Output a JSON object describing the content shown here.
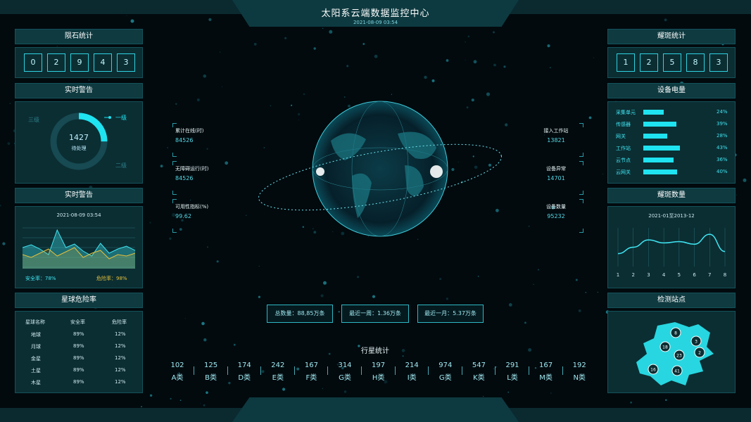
{
  "header": {
    "title": "太阳系云端数据监控中心",
    "datetime": "2021-08-09  03:54"
  },
  "meteor": {
    "title": "陨石统计",
    "digits": [
      "0",
      "2",
      "9",
      "4",
      "3"
    ]
  },
  "alert1": {
    "title": "实时警告",
    "center_value": "1427",
    "center_label": "待处理",
    "level1": "一级",
    "level2": "二级",
    "level3": "三级",
    "progress": 0.25
  },
  "alert2": {
    "title": "实时警告",
    "datetime": "2021-08-09  03:54",
    "safe_label": "安全率：78%",
    "danger_label": "危险率：98%",
    "chart_data": {
      "type": "area",
      "series": [
        {
          "name": "安全率",
          "values": [
            30,
            34,
            28,
            20,
            55,
            30,
            35,
            25,
            18,
            36,
            22,
            28,
            32,
            26
          ]
        },
        {
          "name": "危险率",
          "values": [
            20,
            16,
            22,
            28,
            18,
            24,
            30,
            16,
            22,
            26,
            14,
            20,
            18,
            22
          ]
        }
      ]
    }
  },
  "danger": {
    "title": "星球危险率",
    "headers": [
      "星球名称",
      "安全率",
      "危险率"
    ],
    "rows": [
      [
        "地球",
        "89%",
        "12%"
      ],
      [
        "月球",
        "89%",
        "12%"
      ],
      [
        "金星",
        "89%",
        "12%"
      ],
      [
        "土星",
        "89%",
        "12%"
      ],
      [
        "木星",
        "89%",
        "12%"
      ]
    ]
  },
  "left_stats": [
    {
      "label": "累计在线(时)",
      "value": "84526"
    },
    {
      "label": "无障碍运行(时)",
      "value": "84526"
    },
    {
      "label": "可用性指标(%)",
      "value": "99.62"
    }
  ],
  "right_stats": [
    {
      "label": "接入工作站",
      "value": "13821"
    },
    {
      "label": "设备异常",
      "value": "14701"
    },
    {
      "label": "设备数量",
      "value": "95232"
    }
  ],
  "info": {
    "total": "总数量：88,85万条",
    "week": "最近一周：1.36万条",
    "month": "最近一月：5.37万条"
  },
  "planets": {
    "title": "行星统计",
    "items": [
      {
        "num": "102",
        "label": "A类"
      },
      {
        "num": "125",
        "label": "B类"
      },
      {
        "num": "174",
        "label": "D类"
      },
      {
        "num": "242",
        "label": "E类"
      },
      {
        "num": "167",
        "label": "F类"
      },
      {
        "num": "314",
        "label": "G类"
      },
      {
        "num": "197",
        "label": "H类"
      },
      {
        "num": "214",
        "label": "I类"
      },
      {
        "num": "974",
        "label": "G类"
      },
      {
        "num": "547",
        "label": "K类"
      },
      {
        "num": "291",
        "label": "L类"
      },
      {
        "num": "167",
        "label": "M类"
      },
      {
        "num": "192",
        "label": "N类"
      }
    ]
  },
  "flare": {
    "title": "耀斑统计",
    "digits": [
      "1",
      "2",
      "5",
      "8",
      "3"
    ]
  },
  "power": {
    "title": "设备电量",
    "items": [
      {
        "label": "采集单元",
        "pct": "24%",
        "level": 0.24
      },
      {
        "label": "传感器",
        "pct": "39%",
        "level": 0.39
      },
      {
        "label": "网关",
        "pct": "28%",
        "level": 0.28
      },
      {
        "label": "工作站",
        "pct": "43%",
        "level": 0.43
      },
      {
        "label": "云节点",
        "pct": "36%",
        "level": 0.36
      },
      {
        "label": "云网关",
        "pct": "40%",
        "level": 0.4
      }
    ]
  },
  "flare_count": {
    "title": "耀斑数量",
    "range": "2021-01至2013-12",
    "chart_data": {
      "type": "area",
      "categories": [
        "1",
        "2",
        "3",
        "4",
        "5",
        "6",
        "7",
        "8"
      ],
      "values": [
        30,
        45,
        62,
        55,
        58,
        52,
        75,
        35
      ]
    }
  },
  "stations": {
    "title": "检测站点",
    "badges": [
      "8",
      "3",
      "18",
      "2",
      "23",
      "16",
      "41"
    ]
  },
  "colors": {
    "accent": "#2fd3e0",
    "panel": "#0b2e33",
    "gold": "#e6c03a"
  }
}
